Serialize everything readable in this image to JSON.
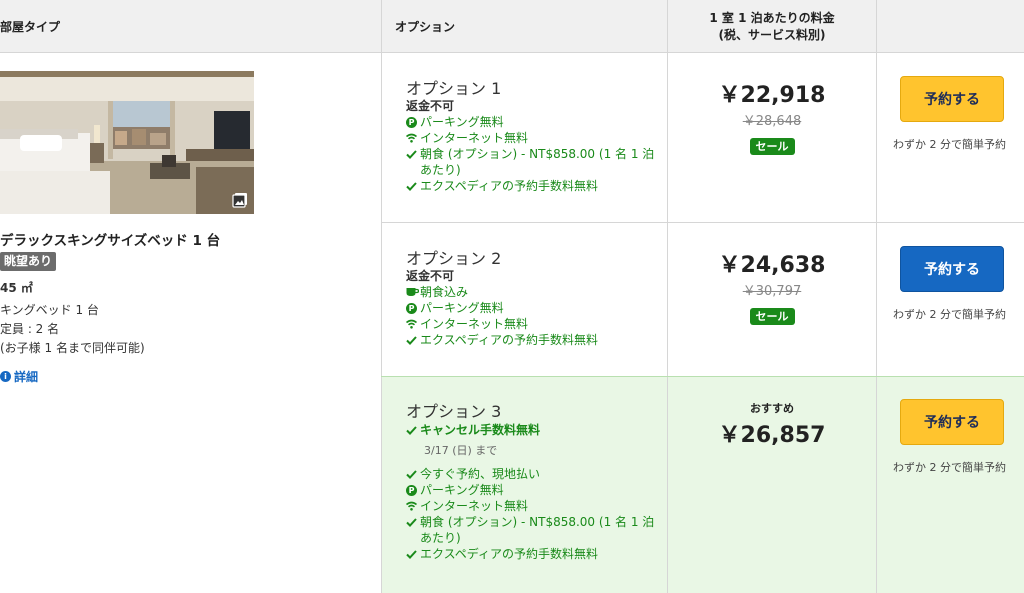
{
  "header": {
    "room_type": "部屋タイプ",
    "options": "オプション",
    "price_line1": "1 室 1 泊あたりの料金",
    "price_line2": "(税、サービス料別)"
  },
  "room": {
    "name": "デラックスキングサイズベッド 1 台",
    "view_badge": "眺望あり",
    "size": "45 ㎡",
    "bed": "キングベッド 1 台",
    "capacity": "定員 : 2 名",
    "child_policy": "(お子様 1 名まで同伴可能)",
    "details_link": "詳細"
  },
  "options": [
    {
      "title": "オプション 1",
      "refund": "返金不可",
      "features": [
        {
          "icon": "parking-icon",
          "text": "パーキング無料"
        },
        {
          "icon": "wifi-icon",
          "text": "インターネット無料"
        },
        {
          "icon": "check-icon",
          "text": "朝食 (オプション) - NT$858.00 (1 名 1 泊あたり)"
        },
        {
          "icon": "check-icon",
          "text": "エクスペディアの予約手数料無料"
        }
      ],
      "price": "￥22,918",
      "old_price": "￥28,648",
      "sale_badge": "セール",
      "book_label": "予約する",
      "book_note": "わずか 2 分で簡単予約",
      "book_color": "#ffc42e"
    },
    {
      "title": "オプション 2",
      "refund": "返金不可",
      "features": [
        {
          "icon": "breakfast-cup-icon",
          "text": "朝食込み"
        },
        {
          "icon": "parking-icon",
          "text": "パーキング無料"
        },
        {
          "icon": "wifi-icon",
          "text": "インターネット無料"
        },
        {
          "icon": "check-icon",
          "text": "エクスペディアの予約手数料無料"
        }
      ],
      "price": "￥24,638",
      "old_price": "￥30,797",
      "sale_badge": "セール",
      "book_label": "予約する",
      "book_note": "わずか 2 分で簡単予約",
      "book_color": "#1668c2"
    },
    {
      "title": "オプション 3",
      "cancel_free": "キャンセル手数料無料",
      "cancel_until": "3/17 (日) まで",
      "features": [
        {
          "icon": "check-icon",
          "text": "今すぐ予約、現地払い"
        },
        {
          "icon": "parking-icon",
          "text": "パーキング無料"
        },
        {
          "icon": "wifi-icon",
          "text": "インターネット無料"
        },
        {
          "icon": "check-icon",
          "text": "朝食 (オプション) - NT$858.00 (1 名 1 泊あたり)"
        },
        {
          "icon": "check-icon",
          "text": "エクスペディアの予約手数料無料"
        }
      ],
      "recommend": "おすすめ",
      "price": "￥26,857",
      "book_label": "予約する",
      "book_note": "わずか 2 分で簡単予約",
      "book_color": "#ffc42e"
    }
  ],
  "colors": {
    "green": "#1a8a1a",
    "blue": "#1668c2",
    "yellow": "#ffc42e",
    "recommended_bg": "#e9f7e5"
  }
}
